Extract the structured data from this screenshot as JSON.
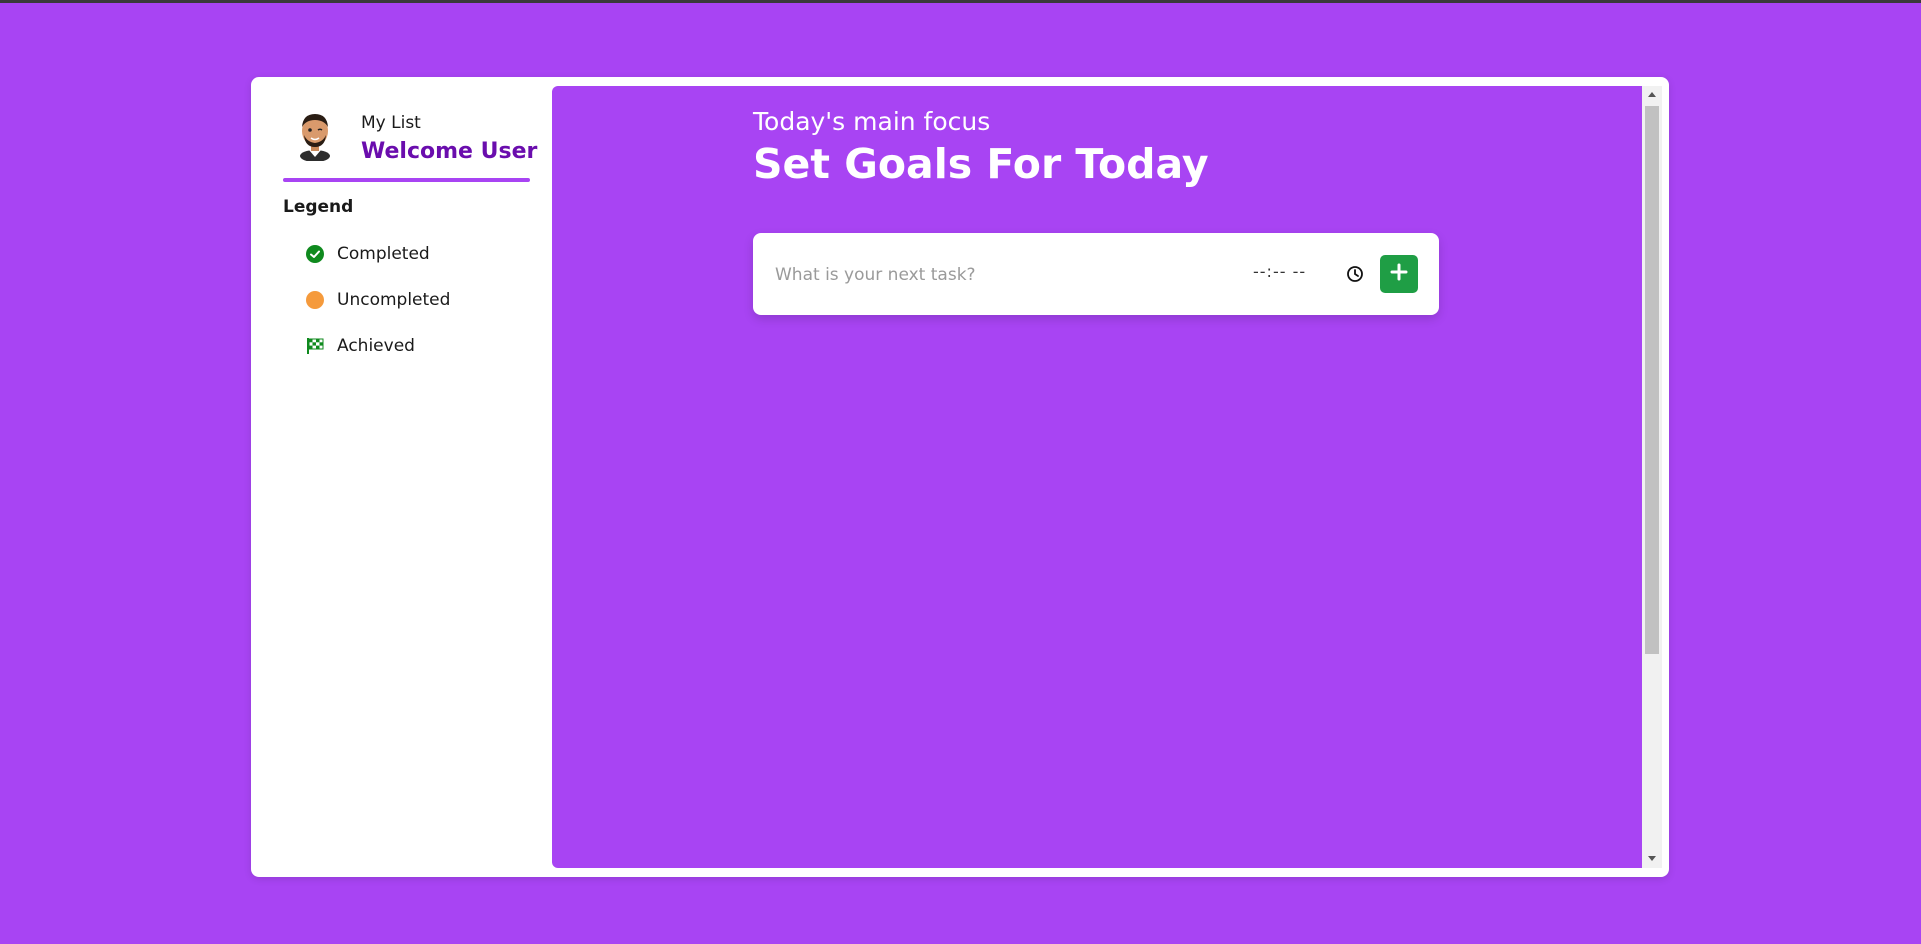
{
  "sidebar": {
    "list_label": "My List",
    "welcome": "Welcome User",
    "legend_title": "Legend",
    "legend": [
      {
        "label": "Completed",
        "icon": "check-circle-icon",
        "color": "#0f8a1e"
      },
      {
        "label": "Uncompleted",
        "icon": "orange-dot-icon",
        "color": "#f59a3c"
      },
      {
        "label": "Achieved",
        "icon": "checkered-flag-icon",
        "color": "#0f8a1e"
      }
    ]
  },
  "main": {
    "subtitle": "Today's main focus",
    "title": "Set Goals For Today",
    "task_placeholder": "What is your next task?",
    "time_placeholder": "--:-- --",
    "add_icon": "plus-icon",
    "clock_icon": "clock-icon"
  },
  "colors": {
    "background": "#a844f3",
    "accent": "#6a0dad",
    "add_button": "#1f9e45"
  }
}
